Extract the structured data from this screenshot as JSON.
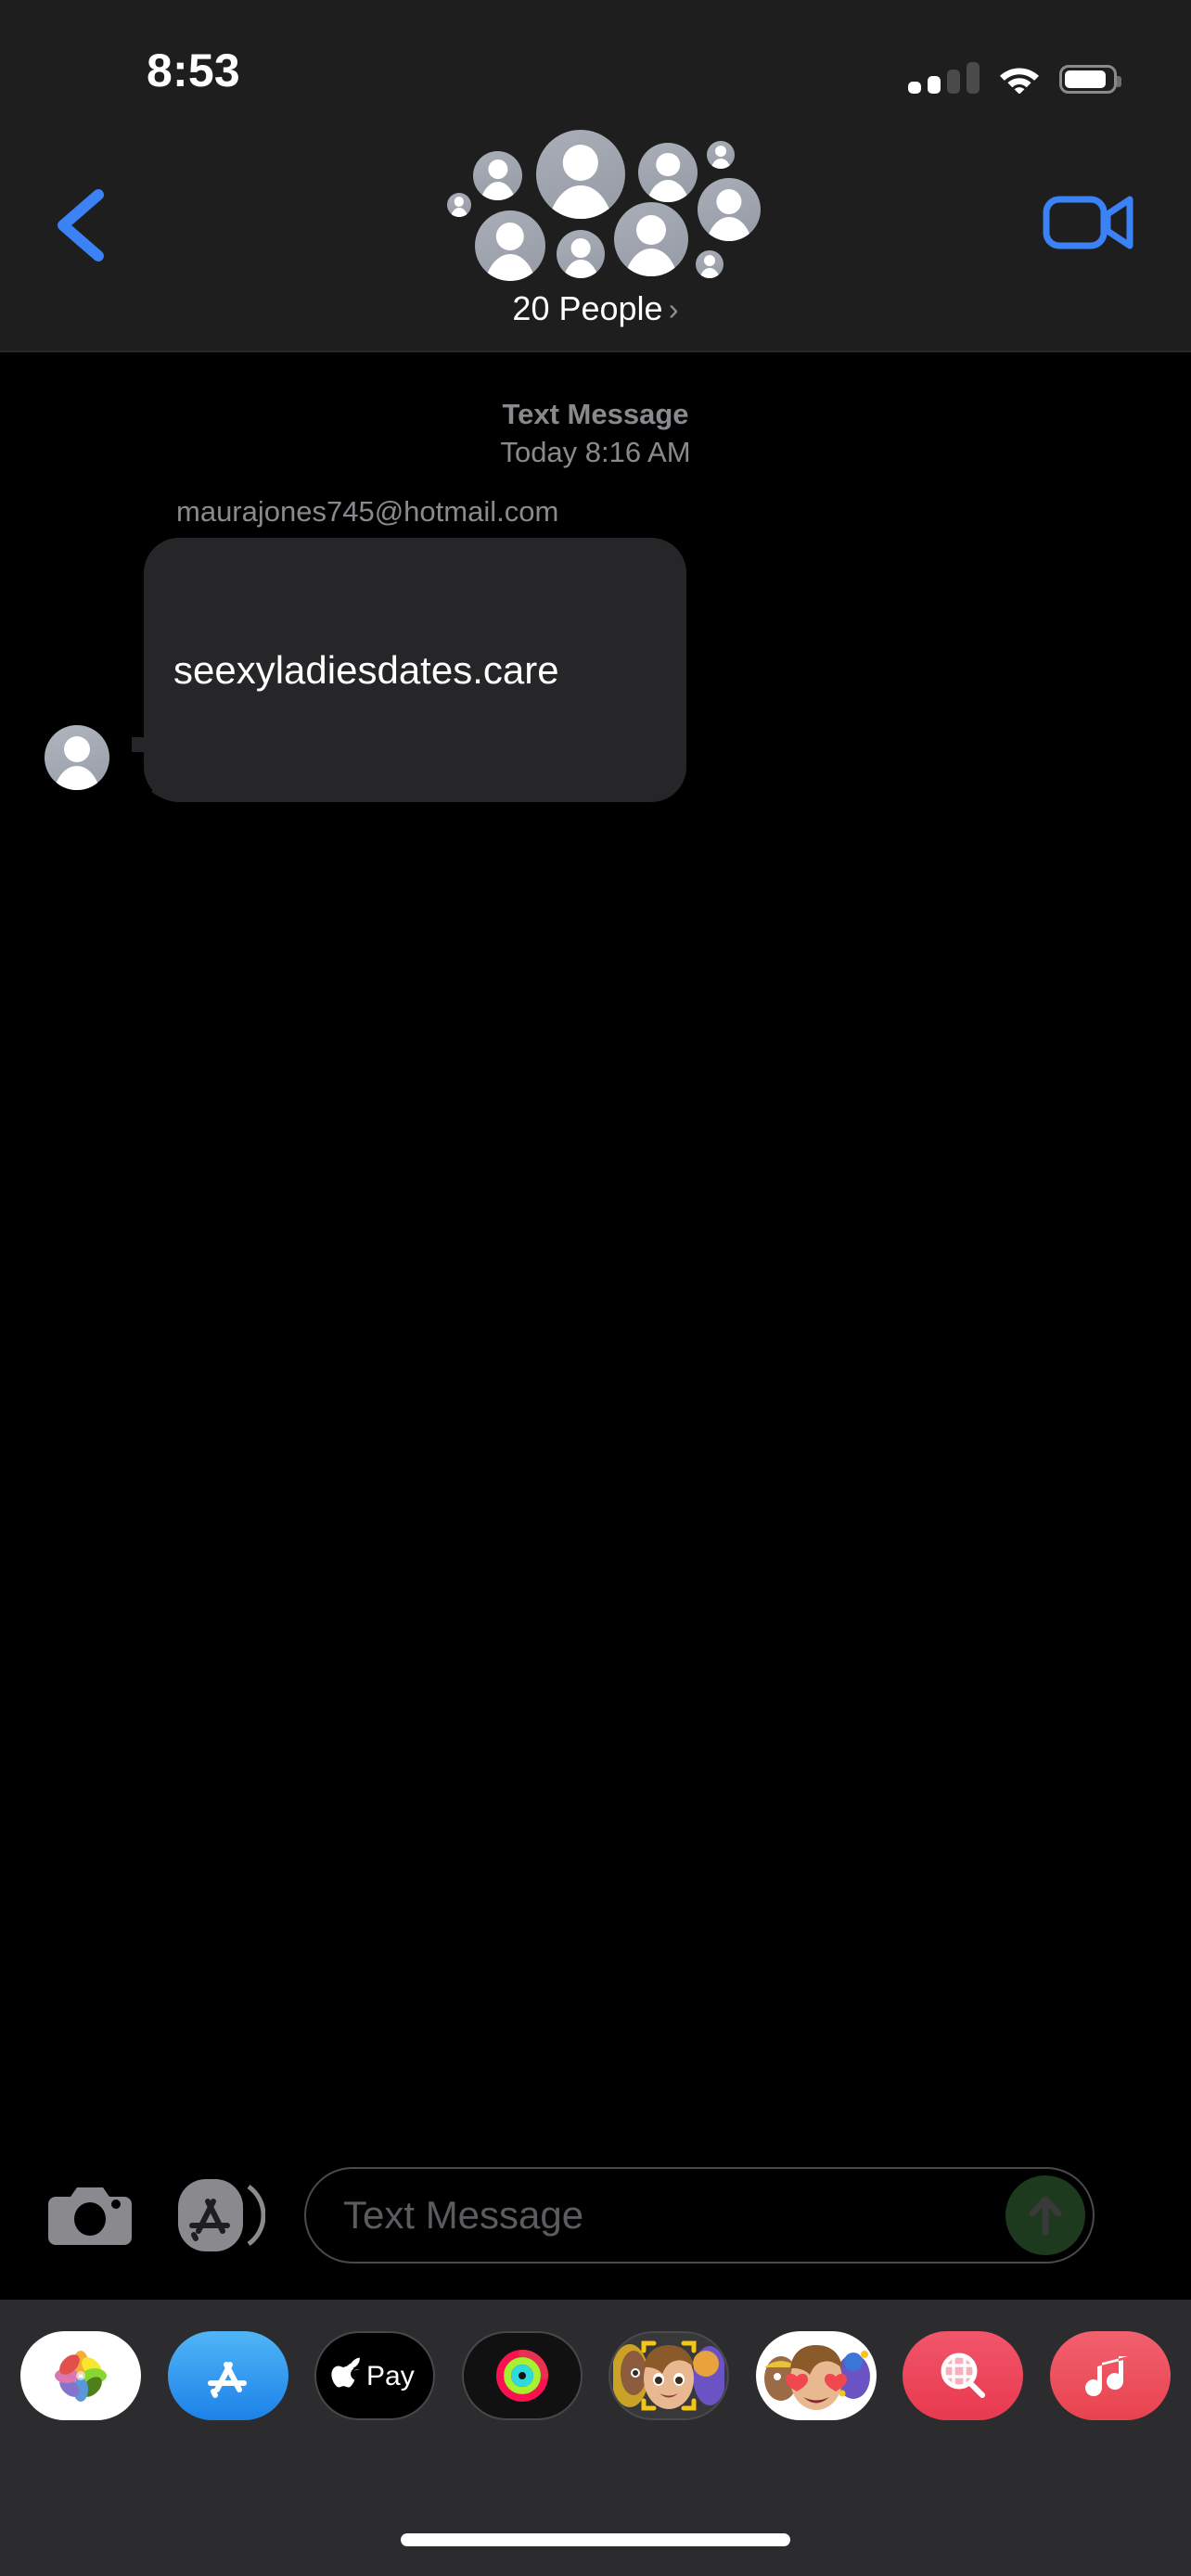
{
  "status_bar": {
    "time": "8:53",
    "signal_icon": "cellular-signal-icon",
    "signal_bars_filled": 2,
    "signal_bars_total": 4,
    "wifi_icon": "wifi-icon",
    "battery_icon": "battery-icon",
    "battery_level_pct": 88
  },
  "nav": {
    "back_icon": "chevron-left-icon",
    "facetime_icon": "video-camera-icon",
    "group_title": "20 People",
    "group_chevron": "›",
    "avatar_count": 11,
    "accent_color": "#3B82F6",
    "bar_color": "#1E1E1E"
  },
  "conversation": {
    "service_label": "Text Message",
    "timestamp": "Today 8:16 AM",
    "messages": [
      {
        "sender": "maurajones745@hotmail.com",
        "text": "seexyladiesdates.care",
        "direction": "incoming",
        "bubble_color": "#262628",
        "text_color": "#FFFFFF"
      }
    ]
  },
  "input_bar": {
    "camera_icon": "camera-icon",
    "apps_icon": "app-store-icon",
    "placeholder": "Text Message",
    "value": "",
    "send_icon": "arrow-up-icon",
    "send_enabled": false,
    "send_color": "#1E3A1E"
  },
  "app_drawer": {
    "background": "#2C2C2E",
    "apps": [
      {
        "name": "photos-app",
        "label": "Photos",
        "icon": "photos-pinwheel-icon"
      },
      {
        "name": "app-store-app",
        "label": "App Store",
        "icon": "app-store-icon"
      },
      {
        "name": "apple-pay-app",
        "label": "Apple Pay",
        "icon": "apple-pay-icon"
      },
      {
        "name": "fitness-app",
        "label": "Fitness",
        "icon": "activity-rings-icon"
      },
      {
        "name": "memoji-app",
        "label": "Memoji",
        "icon": "memoji-face-icon"
      },
      {
        "name": "memoji-stickers-app",
        "label": "Memoji Stickers",
        "icon": "memoji-heart-eyes-icon"
      },
      {
        "name": "images-app",
        "label": "#images",
        "icon": "magnifier-grid-icon"
      },
      {
        "name": "music-app",
        "label": "Music",
        "icon": "music-note-icon"
      }
    ]
  },
  "home_indicator": "home-indicator"
}
